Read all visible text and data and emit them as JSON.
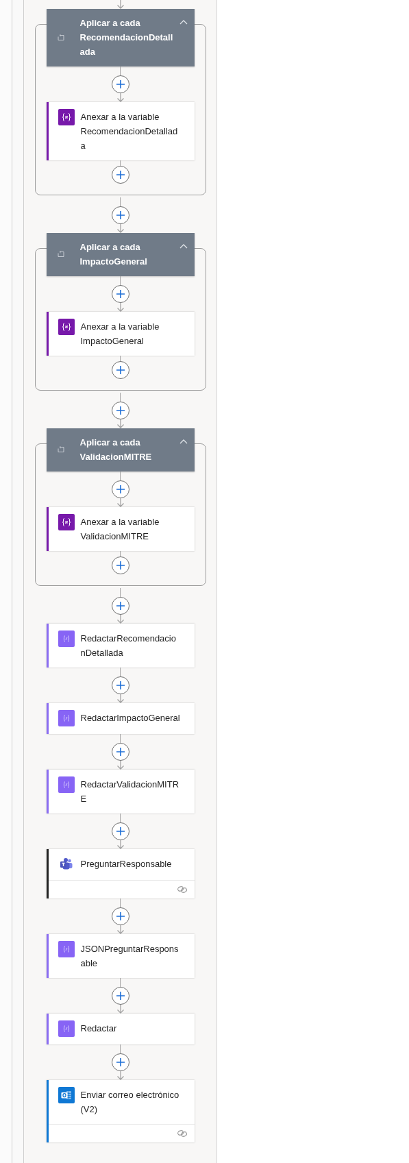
{
  "steps": [
    {
      "kind": "loop",
      "title": "Aplicar a cada RecomendacionDetallada",
      "expanded": true,
      "children": [
        {
          "kind": "variable",
          "title": "Anexar a la variable RecomendacionDetallada"
        }
      ]
    },
    {
      "kind": "loop",
      "title": "Aplicar a cada ImpactoGeneral",
      "expanded": true,
      "children": [
        {
          "kind": "variable",
          "title": "Anexar a la variable ImpactoGeneral"
        }
      ]
    },
    {
      "kind": "loop",
      "title": "Aplicar a cada ValidacionMITRE",
      "expanded": true,
      "children": [
        {
          "kind": "variable",
          "title": "Anexar a la variable ValidacionMITRE"
        }
      ]
    },
    {
      "kind": "compose",
      "title": "RedactarRecomendacionDetallada"
    },
    {
      "kind": "compose",
      "title": "RedactarImpactoGeneral"
    },
    {
      "kind": "compose",
      "title": "RedactarValidacionMITRE"
    },
    {
      "kind": "teams",
      "title": "PreguntarResponsable",
      "connection": true
    },
    {
      "kind": "compose",
      "title": "JSONPreguntarResponsable"
    },
    {
      "kind": "compose",
      "title": "Redactar"
    },
    {
      "kind": "outlook",
      "title": "Enviar correo electrónico (V2)",
      "connection": true
    }
  ]
}
